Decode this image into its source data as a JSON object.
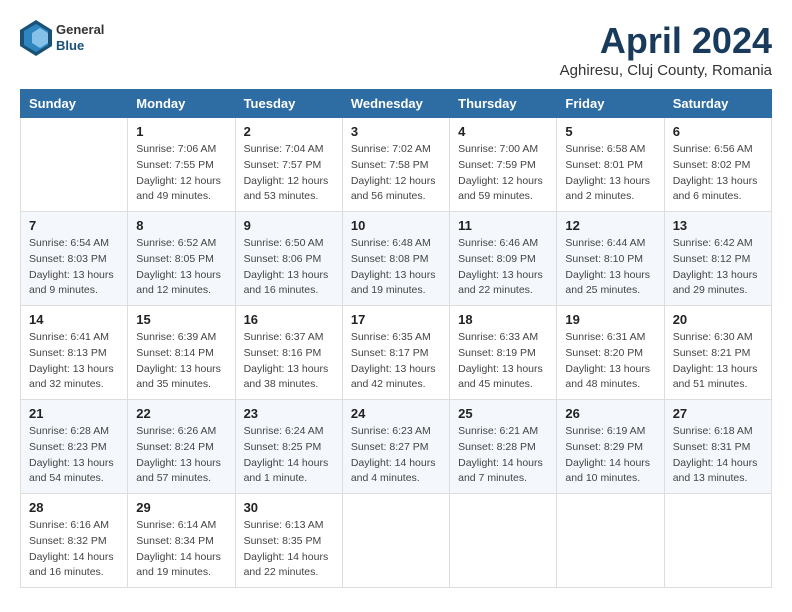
{
  "header": {
    "logo_general": "General",
    "logo_blue": "Blue",
    "main_title": "April 2024",
    "subtitle": "Aghiresu, Cluj County, Romania"
  },
  "days_of_week": [
    "Sunday",
    "Monday",
    "Tuesday",
    "Wednesday",
    "Thursday",
    "Friday",
    "Saturday"
  ],
  "weeks": [
    [
      {
        "day": "",
        "content": ""
      },
      {
        "day": "1",
        "content": "Sunrise: 7:06 AM\nSunset: 7:55 PM\nDaylight: 12 hours\nand 49 minutes."
      },
      {
        "day": "2",
        "content": "Sunrise: 7:04 AM\nSunset: 7:57 PM\nDaylight: 12 hours\nand 53 minutes."
      },
      {
        "day": "3",
        "content": "Sunrise: 7:02 AM\nSunset: 7:58 PM\nDaylight: 12 hours\nand 56 minutes."
      },
      {
        "day": "4",
        "content": "Sunrise: 7:00 AM\nSunset: 7:59 PM\nDaylight: 12 hours\nand 59 minutes."
      },
      {
        "day": "5",
        "content": "Sunrise: 6:58 AM\nSunset: 8:01 PM\nDaylight: 13 hours\nand 2 minutes."
      },
      {
        "day": "6",
        "content": "Sunrise: 6:56 AM\nSunset: 8:02 PM\nDaylight: 13 hours\nand 6 minutes."
      }
    ],
    [
      {
        "day": "7",
        "content": "Sunrise: 6:54 AM\nSunset: 8:03 PM\nDaylight: 13 hours\nand 9 minutes."
      },
      {
        "day": "8",
        "content": "Sunrise: 6:52 AM\nSunset: 8:05 PM\nDaylight: 13 hours\nand 12 minutes."
      },
      {
        "day": "9",
        "content": "Sunrise: 6:50 AM\nSunset: 8:06 PM\nDaylight: 13 hours\nand 16 minutes."
      },
      {
        "day": "10",
        "content": "Sunrise: 6:48 AM\nSunset: 8:08 PM\nDaylight: 13 hours\nand 19 minutes."
      },
      {
        "day": "11",
        "content": "Sunrise: 6:46 AM\nSunset: 8:09 PM\nDaylight: 13 hours\nand 22 minutes."
      },
      {
        "day": "12",
        "content": "Sunrise: 6:44 AM\nSunset: 8:10 PM\nDaylight: 13 hours\nand 25 minutes."
      },
      {
        "day": "13",
        "content": "Sunrise: 6:42 AM\nSunset: 8:12 PM\nDaylight: 13 hours\nand 29 minutes."
      }
    ],
    [
      {
        "day": "14",
        "content": "Sunrise: 6:41 AM\nSunset: 8:13 PM\nDaylight: 13 hours\nand 32 minutes."
      },
      {
        "day": "15",
        "content": "Sunrise: 6:39 AM\nSunset: 8:14 PM\nDaylight: 13 hours\nand 35 minutes."
      },
      {
        "day": "16",
        "content": "Sunrise: 6:37 AM\nSunset: 8:16 PM\nDaylight: 13 hours\nand 38 minutes."
      },
      {
        "day": "17",
        "content": "Sunrise: 6:35 AM\nSunset: 8:17 PM\nDaylight: 13 hours\nand 42 minutes."
      },
      {
        "day": "18",
        "content": "Sunrise: 6:33 AM\nSunset: 8:19 PM\nDaylight: 13 hours\nand 45 minutes."
      },
      {
        "day": "19",
        "content": "Sunrise: 6:31 AM\nSunset: 8:20 PM\nDaylight: 13 hours\nand 48 minutes."
      },
      {
        "day": "20",
        "content": "Sunrise: 6:30 AM\nSunset: 8:21 PM\nDaylight: 13 hours\nand 51 minutes."
      }
    ],
    [
      {
        "day": "21",
        "content": "Sunrise: 6:28 AM\nSunset: 8:23 PM\nDaylight: 13 hours\nand 54 minutes."
      },
      {
        "day": "22",
        "content": "Sunrise: 6:26 AM\nSunset: 8:24 PM\nDaylight: 13 hours\nand 57 minutes."
      },
      {
        "day": "23",
        "content": "Sunrise: 6:24 AM\nSunset: 8:25 PM\nDaylight: 14 hours\nand 1 minute."
      },
      {
        "day": "24",
        "content": "Sunrise: 6:23 AM\nSunset: 8:27 PM\nDaylight: 14 hours\nand 4 minutes."
      },
      {
        "day": "25",
        "content": "Sunrise: 6:21 AM\nSunset: 8:28 PM\nDaylight: 14 hours\nand 7 minutes."
      },
      {
        "day": "26",
        "content": "Sunrise: 6:19 AM\nSunset: 8:29 PM\nDaylight: 14 hours\nand 10 minutes."
      },
      {
        "day": "27",
        "content": "Sunrise: 6:18 AM\nSunset: 8:31 PM\nDaylight: 14 hours\nand 13 minutes."
      }
    ],
    [
      {
        "day": "28",
        "content": "Sunrise: 6:16 AM\nSunset: 8:32 PM\nDaylight: 14 hours\nand 16 minutes."
      },
      {
        "day": "29",
        "content": "Sunrise: 6:14 AM\nSunset: 8:34 PM\nDaylight: 14 hours\nand 19 minutes."
      },
      {
        "day": "30",
        "content": "Sunrise: 6:13 AM\nSunset: 8:35 PM\nDaylight: 14 hours\nand 22 minutes."
      },
      {
        "day": "",
        "content": ""
      },
      {
        "day": "",
        "content": ""
      },
      {
        "day": "",
        "content": ""
      },
      {
        "day": "",
        "content": ""
      }
    ]
  ]
}
